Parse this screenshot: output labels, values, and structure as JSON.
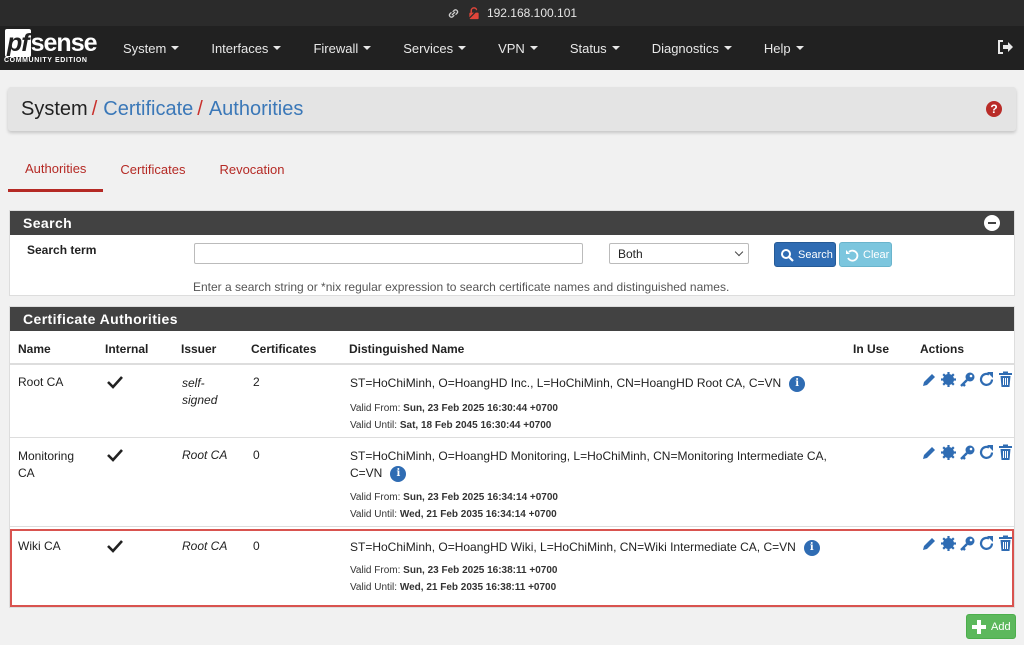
{
  "browser": {
    "address": "192.168.100.101"
  },
  "brand": {
    "name_pf": "pf",
    "name_rest": "sense",
    "edition": "COMMUNITY EDITION"
  },
  "nav": {
    "items": [
      {
        "label": "System"
      },
      {
        "label": "Interfaces"
      },
      {
        "label": "Firewall"
      },
      {
        "label": "Services"
      },
      {
        "label": "VPN"
      },
      {
        "label": "Status"
      },
      {
        "label": "Diagnostics"
      },
      {
        "label": "Help"
      }
    ]
  },
  "breadcrumb": {
    "root": "System",
    "level1": "Certificate",
    "level2": "Authorities",
    "separator": "/",
    "help_symbol": "?"
  },
  "tabs": [
    {
      "label": "Authorities",
      "active": true
    },
    {
      "label": "Certificates",
      "active": false
    },
    {
      "label": "Revocation",
      "active": false
    }
  ],
  "search": {
    "title": "Search",
    "term_label": "Search term",
    "term_value": "",
    "scope_value": "Both",
    "search_button": "Search",
    "clear_button": "Clear",
    "hint": "Enter a search string or *nix regular expression to search certificate names and distinguished names."
  },
  "ca_table": {
    "title": "Certificate Authorities",
    "columns": {
      "name": "Name",
      "internal": "Internal",
      "issuer": "Issuer",
      "certificates": "Certificates",
      "dn": "Distinguished Name",
      "in_use": "In Use",
      "actions": "Actions"
    },
    "rows": [
      {
        "name": "Root CA",
        "internal": true,
        "issuer": "self-signed",
        "certificates": "2",
        "dn": "ST=HoChiMinh, O=HoangHD Inc., L=HoChiMinh, CN=HoangHD Root CA, C=VN",
        "valid_from_label": "Valid From:",
        "valid_from": "Sun, 23 Feb 2025 16:30:44 +0700",
        "valid_until_label": "Valid Until:",
        "valid_until": "Sat, 18 Feb 2045 16:30:44 +0700",
        "highlighted": false
      },
      {
        "name": "Monitoring CA",
        "internal": true,
        "issuer": "Root CA",
        "certificates": "0",
        "dn": "ST=HoChiMinh, O=HoangHD Monitoring, L=HoChiMinh, CN=Monitoring Intermediate CA, C=VN",
        "valid_from_label": "Valid From:",
        "valid_from": "Sun, 23 Feb 2025 16:34:14 +0700",
        "valid_until_label": "Valid Until:",
        "valid_until": "Wed, 21 Feb 2035 16:34:14 +0700",
        "highlighted": false
      },
      {
        "name": "Wiki CA",
        "internal": true,
        "issuer": "Root CA",
        "certificates": "0",
        "dn": "ST=HoChiMinh, O=HoangHD Wiki, L=HoChiMinh, CN=Wiki Intermediate CA, C=VN",
        "valid_from_label": "Valid From:",
        "valid_from": "Sun, 23 Feb 2025 16:38:11 +0700",
        "valid_until_label": "Valid Until:",
        "valid_until": "Wed, 21 Feb 2035 16:38:11 +0700",
        "highlighted": true
      }
    ],
    "info_symbol": "i"
  },
  "add_button": {
    "label": "Add"
  },
  "colors": {
    "link": "#3b78b8",
    "accent_red": "#b52a25",
    "primary": "#2f6cb3",
    "success": "#5cb85c",
    "header_dark": "#424242"
  },
  "icons": {
    "actions": [
      "pencil-icon",
      "gear-badge-icon",
      "key-icon",
      "refresh-icon",
      "trash-icon"
    ],
    "check": "check-icon",
    "logout": "logout-icon"
  }
}
